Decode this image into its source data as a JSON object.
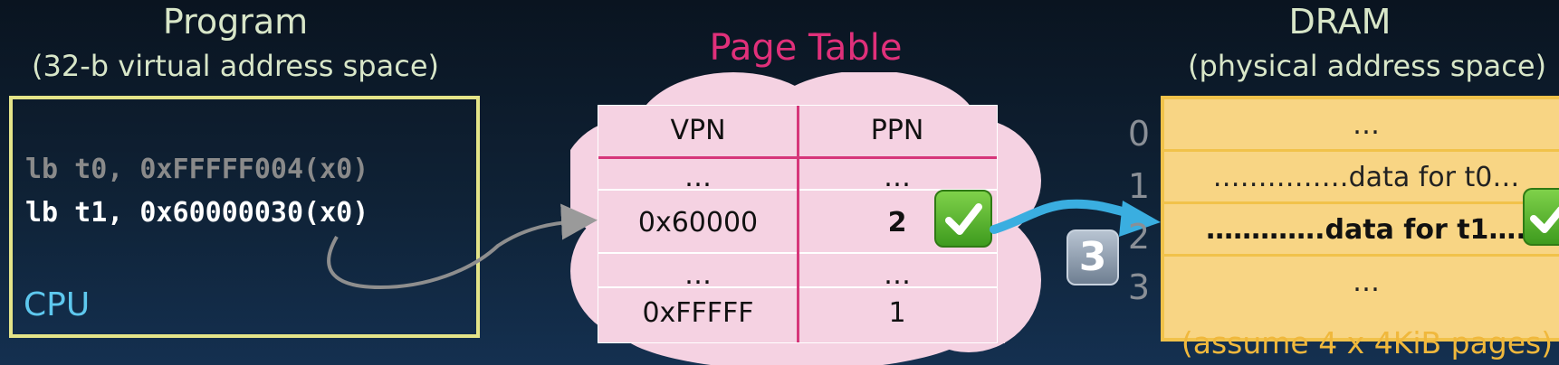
{
  "program": {
    "title": "Program",
    "subtitle": "(32-b virtual address space)",
    "code_lines": [
      "lb t0, 0xFFFFF004(x0)",
      "lb t1, 0x60000030(x0)"
    ],
    "cpu_label": "CPU"
  },
  "page_table": {
    "title": "Page Table",
    "headers": [
      "VPN",
      "PPN"
    ],
    "rows": [
      [
        "…",
        "…"
      ],
      [
        "0x60000",
        "2"
      ],
      [
        "…",
        "…"
      ],
      [
        "0xFFFFF",
        "1"
      ]
    ]
  },
  "dram": {
    "title": "DRAM",
    "subtitle": "(physical address space)",
    "row_indices": [
      "0",
      "1",
      "2",
      "3"
    ],
    "rows": [
      "…",
      "……………data for t0…",
      "………….data for t1….",
      "…"
    ],
    "note": "(assume 4 x 4KiB pages)"
  },
  "step_badge": "3",
  "icons": {
    "check": "check-mark-icon"
  },
  "colors": {
    "program_box_border": "#e4e488",
    "cpu_label": "#5ec8ee",
    "page_table_title": "#e0307a",
    "table_divider": "#d6367a",
    "cloud": "#f5d2e2",
    "dram_fill": "#f8d584",
    "dram_border": "#f1c24a",
    "arrow_blue": "#3aaee0",
    "check_green": "#4cb52a"
  }
}
